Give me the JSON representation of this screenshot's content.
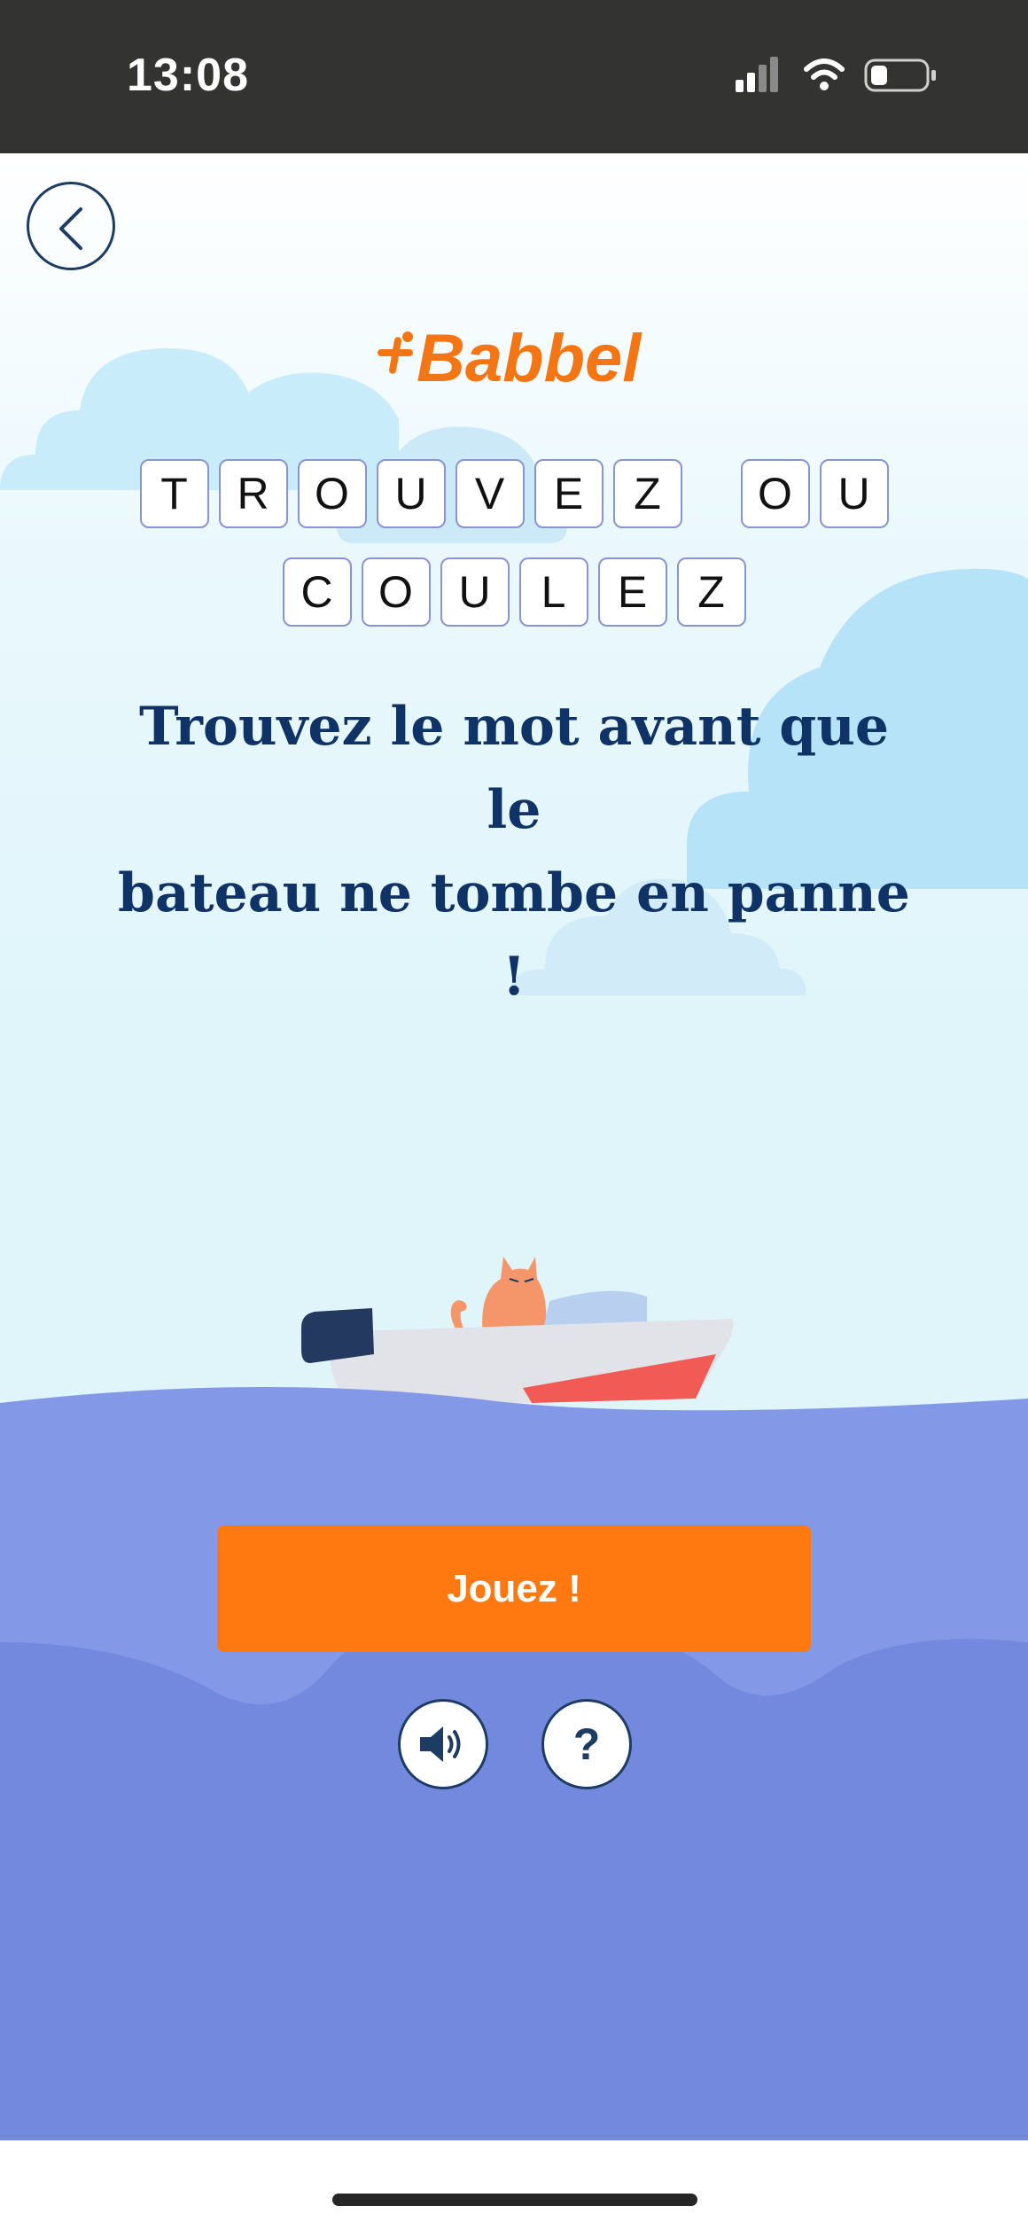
{
  "status_bar": {
    "time": "13:08"
  },
  "header": {
    "back_icon": "chevron-left-icon",
    "logo_text": "Babbel",
    "logo_color": "#f47514"
  },
  "game": {
    "title_words_row1": [
      "TROUVEZ",
      "OU"
    ],
    "title_row1_letters": [
      "T",
      "R",
      "O",
      "U",
      "V",
      "E",
      "Z",
      " ",
      "O",
      "U"
    ],
    "title_row2_letters": [
      "C",
      "O",
      "U",
      "L",
      "E",
      "Z"
    ],
    "headline_line1": "Trouvez le mot avant que le",
    "headline_line2": "bateau ne tombe en panne",
    "headline_line3": "!"
  },
  "actions": {
    "play_label": "Jouez !",
    "play_color": "#ff7810",
    "sound_icon": "speaker-icon",
    "help_label": "?"
  },
  "colors": {
    "headline": "#0f3366",
    "sea_top": "#8399e8",
    "sea_bottom": "#7289de",
    "sky": "#dff5fa"
  }
}
